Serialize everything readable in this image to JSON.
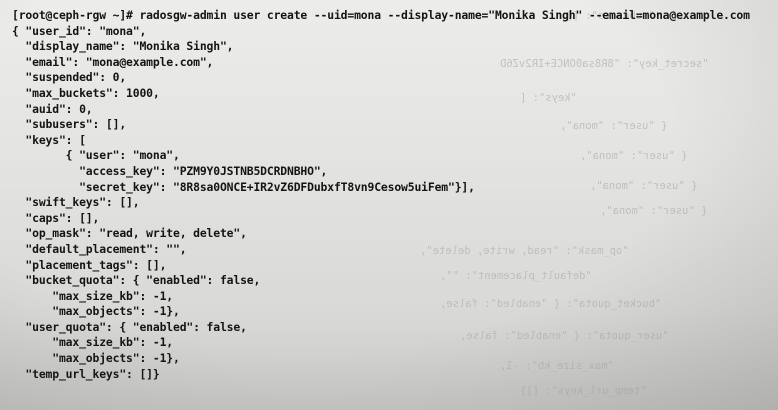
{
  "terminal": {
    "lines": [
      "[root@ceph-rgw ~]# radosgw-admin user create --uid=mona --display-name=\"Monika Singh\" --email=mona@example.com",
      "{ \"user_id\": \"mona\",",
      "  \"display_name\": \"Monika Singh\",",
      "  \"email\": \"mona@example.com\",",
      "  \"suspended\": 0,",
      "  \"max_buckets\": 1000,",
      "  \"auid\": 0,",
      "  \"subusers\": [],",
      "  \"keys\": [",
      "        { \"user\": \"mona\",",
      "          \"access_key\": \"PZM9Y0JSTNB5DCRDNBHO\",",
      "          \"secret_key\": \"8R8sa0ONCE+IR2vZ6DFDubxfT8vn9Cesow5uiFem\"}],",
      "  \"swift_keys\": [],",
      "  \"caps\": [],",
      "  \"op_mask\": \"read, write, delete\",",
      "  \"default_placement\": \"\",",
      "  \"placement_tags\": [],",
      "  \"bucket_quota\": { \"enabled\": false,",
      "      \"max_size_kb\": -1,",
      "      \"max_objects\": -1},",
      "  \"user_quota\": { \"enabled\": false,",
      "      \"max_size_kb\": -1,",
      "      \"max_objects\": -1},",
      "  \"temp_url_keys\": []}"
    ]
  }
}
